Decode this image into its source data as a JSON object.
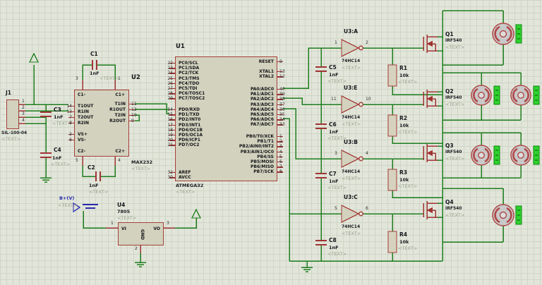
{
  "colors": {
    "background": "#e2e6da",
    "grid": "#cfd5c6",
    "wire_green": "#1e7d1e",
    "symbol_red": "#a03434",
    "component_border": "#a5403c",
    "component_fill": "#d2d2be",
    "text_dark": "#15151a",
    "placeholder_grey": "#9ba28f",
    "battery_blue": "#2a2ab0",
    "motor_badge_green": "#2ed32e"
  },
  "placeholder": "<TEXT>",
  "connector": {
    "ref": "J1",
    "value": "SIL-100-04",
    "pins": [
      "1",
      "2",
      "3",
      "4"
    ]
  },
  "battery": {
    "label": "B+(V)"
  },
  "capacitors": {
    "c1": {
      "ref": "C1",
      "value": "1nF"
    },
    "c2": {
      "ref": "C2",
      "value": "1nF"
    },
    "c3": {
      "ref": "C3",
      "value": "1nF"
    },
    "c4": {
      "ref": "C4",
      "value": "1nF"
    },
    "c5": {
      "ref": "C5",
      "value": "1nF"
    },
    "c6": {
      "ref": "C6",
      "value": "1nF"
    },
    "c7": {
      "ref": "C7",
      "value": "1nF"
    },
    "c8": {
      "ref": "C8",
      "value": "1nF"
    }
  },
  "max232": {
    "ref": "U2",
    "value": "MAX232",
    "top_pins": [
      {
        "num": "3",
        "name": "C1-"
      },
      {
        "num": "1",
        "name": "C1+"
      }
    ],
    "left_a": [
      {
        "num": "14",
        "name": "T1OUT"
      },
      {
        "num": "13",
        "name": "R1IN"
      },
      {
        "num": "7",
        "name": "T2OUT"
      },
      {
        "num": "8",
        "name": "R2IN"
      }
    ],
    "left_b": [
      {
        "num": "2",
        "name": "VS+"
      },
      {
        "num": "6",
        "name": "VS-"
      }
    ],
    "right": [
      {
        "num": "11",
        "name": "T1IN"
      },
      {
        "num": "12",
        "name": "R1OUT"
      },
      {
        "num": "10",
        "name": "T2IN"
      },
      {
        "num": "9",
        "name": "R2OUT"
      }
    ],
    "bottom_pins": [
      {
        "num": "5",
        "name": "C2-"
      },
      {
        "num": "4",
        "name": "C2+"
      }
    ]
  },
  "mcu": {
    "ref": "U1",
    "value": "ATMEGA32",
    "left_groups": [
      [
        {
          "num": "22",
          "name": "PC0/SCL"
        },
        {
          "num": "23",
          "name": "PC1/SDA"
        },
        {
          "num": "24",
          "name": "PC2/TCK"
        },
        {
          "num": "25",
          "name": "PC3/TMS"
        },
        {
          "num": "26",
          "name": "PC4/TDO"
        },
        {
          "num": "27",
          "name": "PC5/TDI"
        },
        {
          "num": "28",
          "name": "PC6/TOSC1"
        },
        {
          "num": "29",
          "name": "PC7/TOSC2"
        }
      ],
      [
        {
          "num": "14",
          "name": "PD0/RXD"
        },
        {
          "num": "15",
          "name": "PD1/TXD"
        },
        {
          "num": "16",
          "name": "PD2/INT0"
        },
        {
          "num": "17",
          "name": "PD3/INT1"
        },
        {
          "num": "18",
          "name": "PD4/OC1B"
        },
        {
          "num": "19",
          "name": "PD5/OC1A"
        },
        {
          "num": "20",
          "name": "PD6/ICP1"
        },
        {
          "num": "21",
          "name": "PD7/OC2"
        }
      ],
      [
        {
          "num": "32",
          "name": "AREF"
        },
        {
          "num": "30",
          "name": "AVCC"
        }
      ]
    ],
    "right_groups": [
      [
        {
          "num": "9",
          "name": "RESET"
        }
      ],
      [
        {
          "num": "13",
          "name": "XTAL1"
        },
        {
          "num": "12",
          "name": "XTAL2"
        }
      ],
      [
        {
          "num": "40",
          "name": "PA0/ADC0"
        },
        {
          "num": "39",
          "name": "PA1/ADC1"
        },
        {
          "num": "38",
          "name": "PA2/ADC2"
        },
        {
          "num": "37",
          "name": "PA3/ADC3"
        },
        {
          "num": "36",
          "name": "PA4/ADC4"
        },
        {
          "num": "35",
          "name": "PA5/ADC5"
        },
        {
          "num": "34",
          "name": "PA6/ADC6"
        },
        {
          "num": "33",
          "name": "PA7/ADC7"
        }
      ],
      [
        {
          "num": "1",
          "name": "PB0/T0/XCK"
        },
        {
          "num": "2",
          "name": "PB1/T1"
        },
        {
          "num": "3",
          "name": "PB2/AIN0/INT2"
        },
        {
          "num": "4",
          "name": "PB3/AIN1/OC0"
        },
        {
          "num": "5",
          "name": "PB4/SS"
        },
        {
          "num": "6",
          "name": "PB5/MOSI"
        },
        {
          "num": "7",
          "name": "PB6/MISO"
        },
        {
          "num": "8",
          "name": "PB7/SCK"
        }
      ]
    ]
  },
  "gates": {
    "a": {
      "ref": "U3:A",
      "type": "74HC14",
      "pin_in": "1",
      "pin_out": "2"
    },
    "e": {
      "ref": "U3:E",
      "type": "74HC14",
      "pin_in": "11",
      "pin_out": "10"
    },
    "b": {
      "ref": "U3:B",
      "type": "74HC14",
      "pin_in": "3",
      "pin_out": "4"
    },
    "c": {
      "ref": "U3:C",
      "type": "74HC14",
      "pin_in": "5",
      "pin_out": "6"
    }
  },
  "resistors": {
    "r1": {
      "ref": "R1",
      "value": "10k"
    },
    "r2": {
      "ref": "R2",
      "value": "10k"
    },
    "r3": {
      "ref": "R3",
      "value": "10k"
    },
    "r4": {
      "ref": "R4",
      "value": "10k"
    }
  },
  "mosfets": {
    "q1": {
      "ref": "Q1",
      "value": "IRF540"
    },
    "q2": {
      "ref": "Q2",
      "value": "IRF540"
    },
    "q3": {
      "ref": "Q3",
      "value": "IRF540"
    },
    "q4": {
      "ref": "Q4",
      "value": "IRF540"
    }
  },
  "regulator": {
    "ref": "U4",
    "value": "7805",
    "pin_in": {
      "num": "1",
      "name": "VI"
    },
    "pin_out": {
      "num": "3",
      "name": "VO"
    },
    "pin_gnd": {
      "num": "2",
      "name": "GND"
    }
  }
}
